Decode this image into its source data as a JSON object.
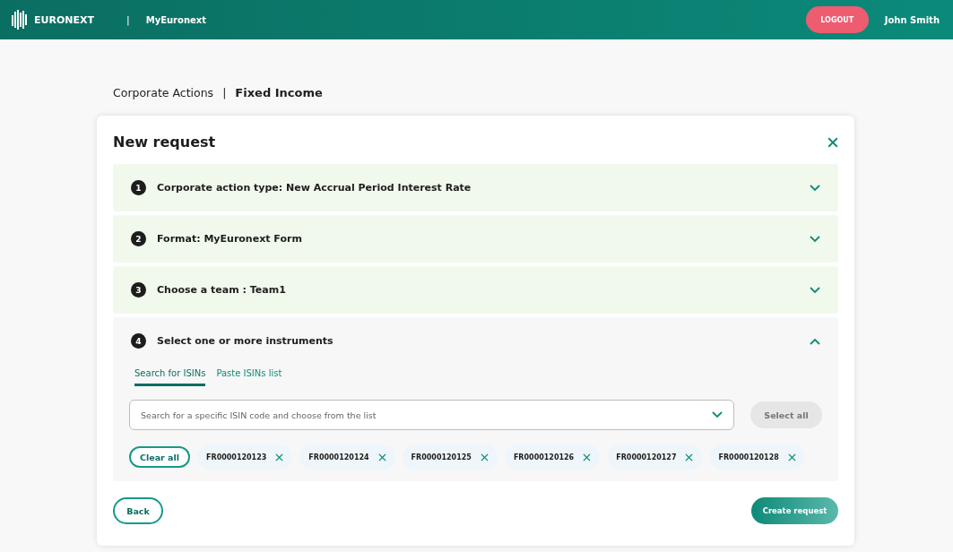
{
  "header": {
    "logo_text": "EURONEXT",
    "separator": "|",
    "app_name": "MyEuronext",
    "logout": "LOGOUT",
    "user": "John Smith"
  },
  "breadcrumb": {
    "parent": "Corporate Actions",
    "separator": "|",
    "current": "Fixed Income"
  },
  "dialog": {
    "title": "New request",
    "steps": [
      {
        "number": "1",
        "label": "Corporate action type: New Accrual Period Interest Rate",
        "expanded": false
      },
      {
        "number": "2",
        "label": "Format: MyEuronext Form",
        "expanded": false
      },
      {
        "number": "3",
        "label": "Choose a team : Team1",
        "expanded": false
      },
      {
        "number": "4",
        "label": "Select one or more instruments",
        "expanded": true
      }
    ],
    "tabs": [
      {
        "label": "Search for ISINs",
        "selected": true
      },
      {
        "label": "Paste ISINs list",
        "selected": false
      }
    ],
    "search": {
      "placeholder": "Search for a specific ISIN code and choose from the list"
    },
    "select_all": "Select all",
    "clear_all": "Clear all",
    "chips": [
      "FR0000120123",
      "FR0000120124",
      "FR0000120125",
      "FR0000120126",
      "FR0000120127",
      "FR0000120128"
    ],
    "back": "Back",
    "create": "Create request"
  }
}
